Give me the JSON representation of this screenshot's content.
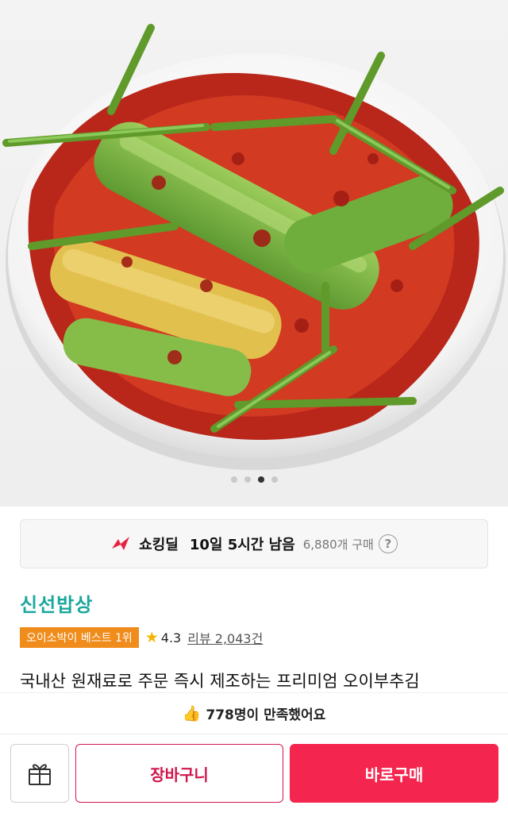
{
  "gallery": {
    "image_alt": "오이소박이",
    "dot_count": 4,
    "active_index": 2
  },
  "deal": {
    "icon": "shocking-deal-icon",
    "label": "쇼킹딜",
    "remaining": "10일 5시간 남음",
    "purchase_count": "6,880개 구매",
    "help_icon": "question-circle-icon",
    "help_glyph": "?"
  },
  "product": {
    "brand": "신선밥상",
    "best_badge": "오이소박이 베스트 1위",
    "star_glyph": "★",
    "rating": "4.3",
    "review_label": "리뷰 2,043건",
    "title": "국내산 원재료로 주문 즉시 제조하는 프리미엄 오이부추김"
  },
  "satisfaction": {
    "icon": "thumbs-up-icon",
    "icon_glyph": "👍",
    "text": "778명이 만족했어요"
  },
  "actions": {
    "gift_icon": "gift-icon",
    "cart_label": "장바구니",
    "buy_label": "바로구매"
  },
  "colors": {
    "brand": "#1aa79c",
    "badge": "#f08c1b",
    "primary": "#f4254e",
    "cart_border": "#d0174b",
    "star": "#f5b400"
  }
}
